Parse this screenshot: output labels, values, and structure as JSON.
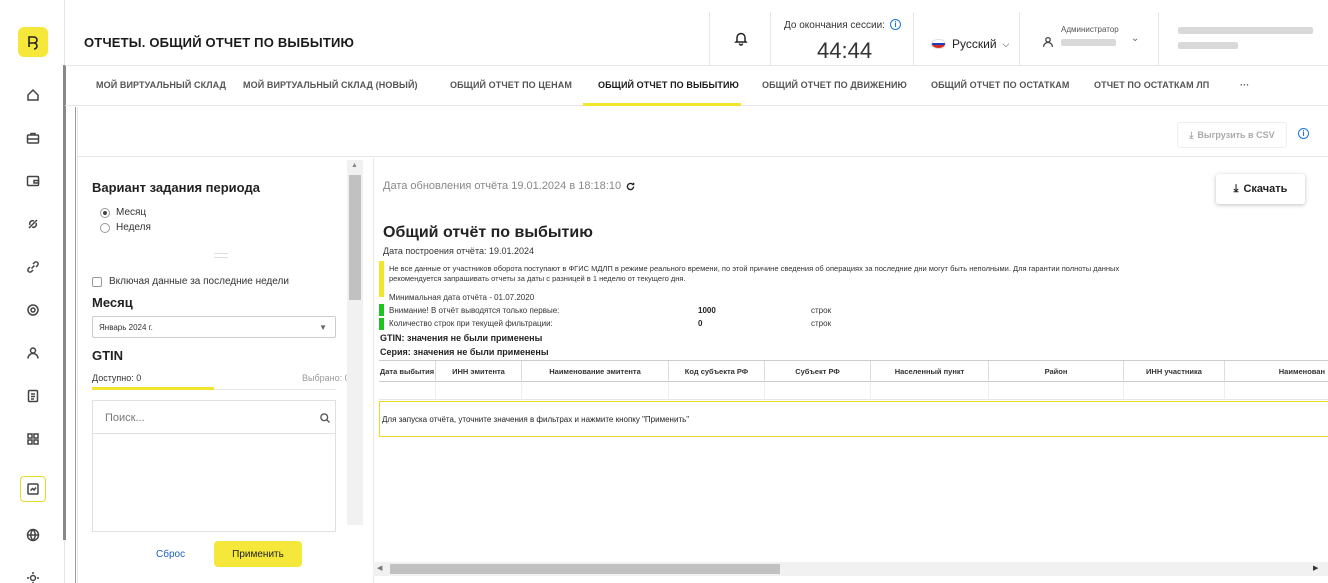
{
  "header": {
    "title": "ОТЧЕТЫ. ОБЩИЙ ОТЧЕТ ПО ВЫБЫТИЮ",
    "session_label": "До окончания сессии:",
    "session_time": "44:44",
    "language": "Русский",
    "user_role": "Администратор"
  },
  "tabs": [
    {
      "label": "МОЙ ВИРТУАЛЬНЫЙ СКЛАД"
    },
    {
      "label": "МОЙ ВИРТУАЛЬНЫЙ СКЛАД (НОВЫЙ)"
    },
    {
      "label": "ОБЩИЙ ОТЧЕТ ПО ЦЕНАМ"
    },
    {
      "label": "ОБЩИЙ ОТЧЕТ ПО ВЫБЫТИЮ"
    },
    {
      "label": "ОБЩИЙ ОТЧЕТ ПО ДВИЖЕНИЮ"
    },
    {
      "label": "ОБЩИЙ ОТЧЕТ ПО ОСТАТКАМ"
    },
    {
      "label": "ОТЧЕТ ПО ОСТАТКАМ ЛП"
    },
    {
      "label": "···"
    }
  ],
  "toolbar": {
    "export_csv_label": "Выгрузить в CSV"
  },
  "filter": {
    "period_title": "Вариант задания периода",
    "radio_month": "Месяц",
    "radio_week": "Неделя",
    "include_weeks_label": "Включая данные за последние недели",
    "month_title": "Месяц",
    "month_value": "Январь 2024 г.",
    "gtin_title": "GTIN",
    "available": "Доступно: 0",
    "selected": "Выбрано: 0",
    "search_placeholder": "Поиск...",
    "reset_label": "Сброс",
    "apply_label": "Применить"
  },
  "report": {
    "updated": "Дата обновления отчёта 19.01.2024 в 18:18:10",
    "download_label": "Скачать",
    "title": "Общий отчёт по выбытию",
    "build_date": "Дата построения отчёта: 19.01.2024",
    "notice": "Не все данные от участников оборота поступают в ФГИС МДЛП в режиме реального времени, по этой причине сведения об операциях за последние дни могут быть неполными. Для гарантии полноты данных рекомендуется запрашивать отчеты за даты с разницей в 1 неделю от текущего дня.",
    "min_date": "Минимальная дата отчёта - 01.07.2020",
    "limit_label": "Внимание! В отчёт выводятся только первые:",
    "limit_value": "1000",
    "limit_unit": "строк",
    "count_label": "Количество строк при текущей фильтрации:",
    "count_value": "0",
    "count_unit": "строк",
    "gtin_note": "GTIN: значения не были применены",
    "series_note": "Серия: значения не были применены",
    "columns": [
      "Дата выбытия",
      "ИНН эмитента",
      "Наименование эмитента",
      "Код субъекта РФ",
      "Субъект РФ",
      "Населенный пункт",
      "Район",
      "ИНН участника",
      "Наименован"
    ],
    "empty_message": "Для запуска отчёта, уточните значения в фильтрах и нажмите кнопку \"Применить\""
  }
}
